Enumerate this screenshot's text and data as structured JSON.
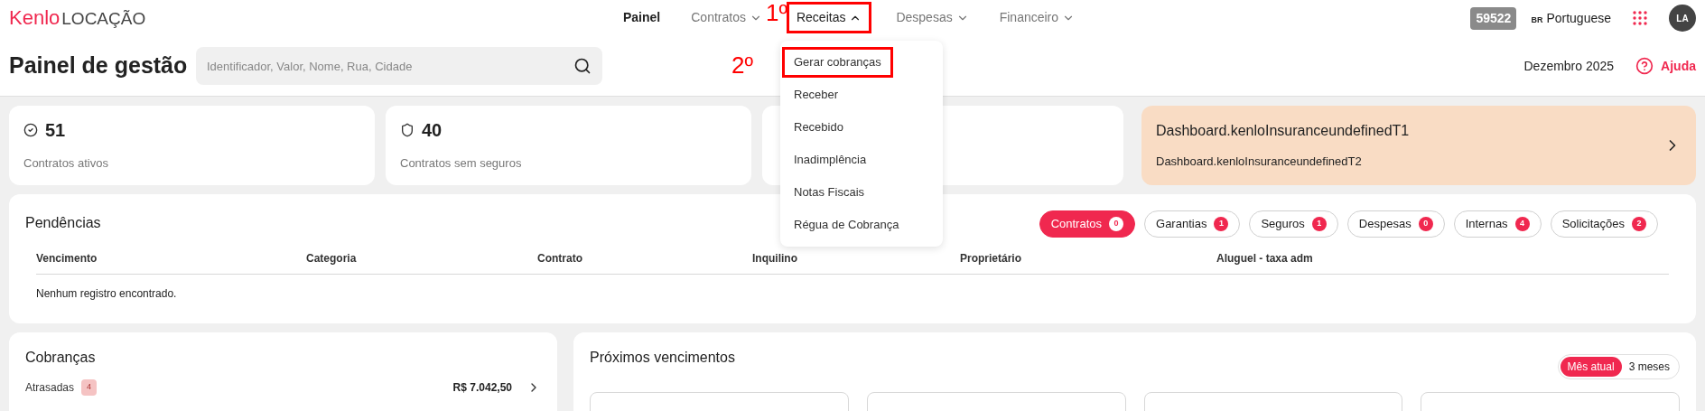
{
  "header": {
    "logo": {
      "brand": "Kenlo",
      "product": "LOCAÇÃO"
    },
    "nav": [
      {
        "label": "Painel",
        "kind": "link",
        "selected": true
      },
      {
        "label": "Contratos",
        "kind": "menu",
        "selected": false,
        "expanded": false
      },
      {
        "label": "Receitas",
        "kind": "menu",
        "selected": false,
        "expanded": true,
        "annotation": "1º"
      },
      {
        "label": "Despesas",
        "kind": "menu",
        "selected": false,
        "expanded": false
      },
      {
        "label": "Financeiro",
        "kind": "menu",
        "selected": false,
        "expanded": false
      }
    ],
    "account_id": "59522",
    "language": {
      "flag": "BR",
      "label": "Portuguese"
    },
    "avatar": "LA"
  },
  "page": {
    "title": "Painel de gestão",
    "search": {
      "placeholder": "Identificador, Valor, Nome, Rua, Cidade"
    },
    "period": "Dezembro 2025",
    "help": "Ajuda"
  },
  "menu": {
    "items": [
      {
        "label": "Gerar cobranças",
        "annotation": "2º"
      },
      {
        "label": "Receber"
      },
      {
        "label": "Recebido"
      },
      {
        "label": "Inadimplência"
      },
      {
        "label": "Notas Fiscais"
      },
      {
        "label": "Régua de Cobrança"
      }
    ]
  },
  "stats": [
    {
      "kind": "stat",
      "value": "51",
      "label": "Contratos ativos"
    },
    {
      "kind": "stat",
      "value": "40",
      "label": "Contratos sem seguros"
    },
    {
      "kind": "covered"
    },
    {
      "kind": "banner",
      "title": "Dashboard.kenloInsuranceundefinedT1",
      "subtitle": "Dashboard.kenloInsuranceundefinedT2"
    }
  ],
  "pendencias": {
    "title": "Pendências",
    "filters": [
      {
        "label": "Contratos",
        "count": "0",
        "selected": true
      },
      {
        "label": "Garantias",
        "count": "1",
        "selected": false
      },
      {
        "label": "Seguros",
        "count": "1",
        "selected": false
      },
      {
        "label": "Despesas",
        "count": "0",
        "selected": false
      },
      {
        "label": "Internas",
        "count": "4",
        "selected": false
      },
      {
        "label": "Solicitações",
        "count": "2",
        "selected": false
      }
    ],
    "columns": [
      "Vencimento",
      "Categoria",
      "Contrato",
      "Inquilino",
      "Proprietário",
      "Aluguel - taxa adm"
    ],
    "empty": "Nenhum registro encontrado."
  },
  "cobrancas": {
    "title": "Cobranças",
    "rows": [
      {
        "label": "Atrasadas",
        "count": "4",
        "amount": "R$ 7.042,50"
      }
    ]
  },
  "proximos": {
    "title": "Próximos vencimentos",
    "ranges": [
      {
        "label": "Mês atual",
        "selected": true
      },
      {
        "label": "3 meses",
        "selected": false
      }
    ]
  }
}
